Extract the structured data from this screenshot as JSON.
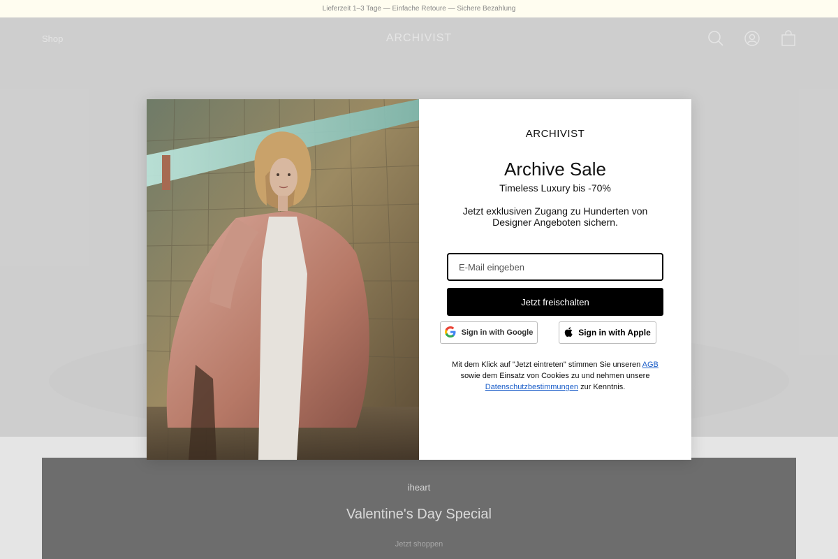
{
  "announcement": "Lieferzeit 1–3 Tage — Einfache Retoure — Sichere Bezahlung",
  "header": {
    "nav_shop": "Shop",
    "logo": "ARCHIVIST",
    "icons": [
      "search-icon",
      "account-icon",
      "cart-icon"
    ]
  },
  "section": {
    "brand": "iheart",
    "title": "Valentine's Day Special",
    "subtitle": "Jetzt shoppen"
  },
  "modal": {
    "logo": "ARCHIVIST",
    "title": "Archive Sale",
    "subtitle": "Timeless Luxury bis -70%",
    "description": "Jetzt exklusiven Zugang zu Hunderten von Designer Angeboten sichern.",
    "email_placeholder": "E-Mail eingeben",
    "submit_label": "Jetzt freischalten",
    "google_label": "Sign in with Google",
    "apple_label": "Sign in with Apple",
    "legal": {
      "part1": "Mit dem Klick auf \"Jetzt eintreten\" stimmen Sie unseren ",
      "link1": "AGB",
      "part2": " sowie dem Einsatz von Cookies zu und nehmen unsere ",
      "link2": "Datenschutzbestimmungen",
      "part3": " zur Kenntnis."
    }
  },
  "colors": {
    "announce_bg": "#fffdf0",
    "button_bg": "#000000",
    "link": "#1a5dc8"
  }
}
